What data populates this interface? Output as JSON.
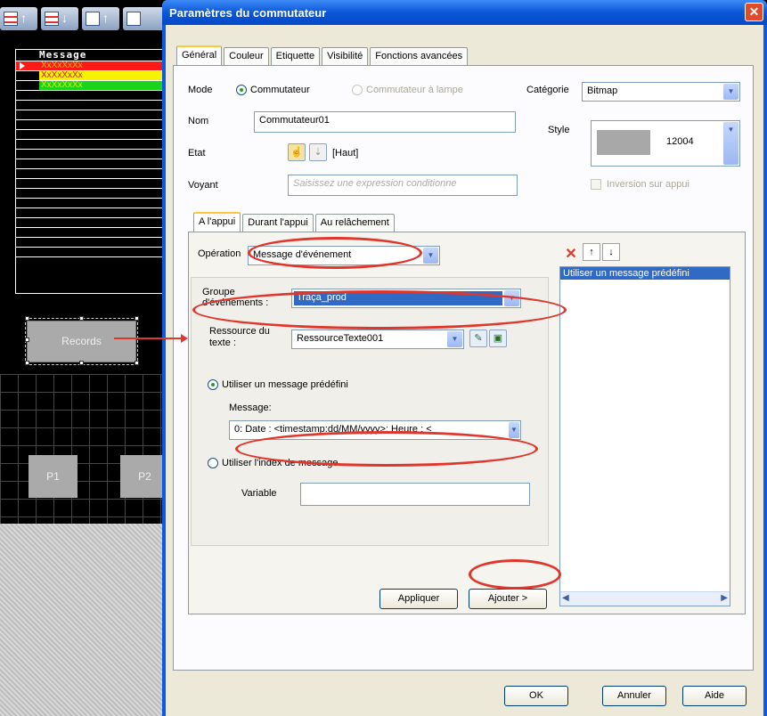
{
  "background": {
    "message_header": "Message",
    "message_rows": [
      "XxXxXxXx",
      "XxXxXxXx",
      "XxXxXxXx"
    ],
    "records_label": "Records",
    "p1_label": "P1",
    "p2_label": "P2"
  },
  "dialog": {
    "title": "Paramètres du commutateur",
    "close_glyph": "✕",
    "tabs": [
      "Général",
      "Couleur",
      "Etiquette",
      "Visibilité",
      "Fonctions avancées"
    ],
    "mode_label": "Mode",
    "mode_options": [
      "Commutateur",
      "Commutateur à lampe"
    ],
    "categorie_label": "Catégorie",
    "categorie_value": "Bitmap",
    "nom_label": "Nom",
    "nom_value": "Commutateur01",
    "style_label": "Style",
    "style_value": "12004",
    "etat_label": "Etat",
    "etat_value": "[Haut]",
    "voyant_label": "Voyant",
    "voyant_placeholder": "Saisissez une expression conditionne",
    "inversion_label": "Inversion sur appui",
    "subtabs": [
      "A l'appui",
      "Durant l'appui",
      "Au relâchement"
    ],
    "operation_label": "Opération",
    "operation_value": "Message d'événement",
    "groupe_label_1": "Groupe",
    "groupe_label_2": "d'événements :",
    "groupe_value": "Traça_prod",
    "ressource_label_1": "Ressource du",
    "ressource_label_2": "texte :",
    "ressource_value": "RessourceTexte001",
    "use_predefined_label": "Utiliser un message prédéfini",
    "message_label": "Message:",
    "message_value": "0: Date : <timestamp:dd/MM/yyyy>; Heure : <",
    "use_index_label": "Utiliser l'index de message",
    "variable_label": "Variable",
    "variable_value": "",
    "appliquer_label": "Appliquer",
    "ajouter_label": "Ajouter >",
    "list_items": [
      "Utiliser un message prédéfini"
    ],
    "ok_label": "OK",
    "annuler_label": "Annuler",
    "aide_label": "Aide"
  },
  "colors": {
    "row_red": "#ff1a1a",
    "row_yellow": "#f6f200",
    "row_green": "#19d419",
    "highlight_oval": "#e0362c",
    "title_bar": "#0a57d8",
    "selection_blue": "#316ac5"
  }
}
